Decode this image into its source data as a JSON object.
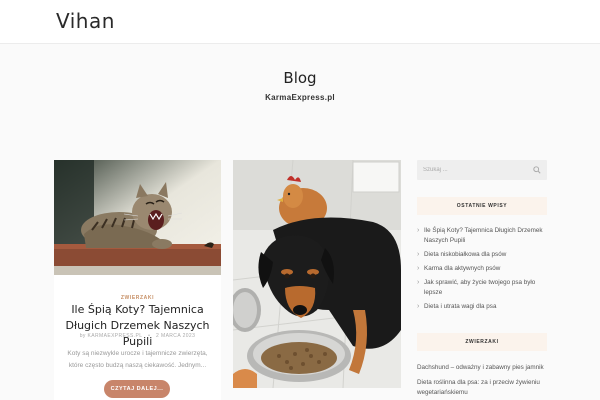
{
  "header": {
    "logo": "Vihan"
  },
  "hero": {
    "title": "Blog",
    "subtitle": "KarmaExpress.pl"
  },
  "post": {
    "category": "ZWIERZAKI",
    "title": "Ile Śpią Koty? Tajemnica Długich Drzemek Naszych Pupili",
    "author": "by KARMAEXPRESS.PL",
    "separator": "•",
    "date": "2 MARCA 2023",
    "excerpt": "Koty są niezwykle urocze i tajemnicze zwierzęta, które często budzą naszą ciekawość. Jednym...",
    "read_more": "CZYTAJ DALEJ..."
  },
  "sidebar": {
    "search_placeholder": "Szukaj ...",
    "recent_title": "OSTATNIE WPISY",
    "recent_posts": [
      "Ile Śpią Koty? Tajemnica Długich Drzemek Naszych Pupili",
      "Dieta niskobiałkowa dla psów",
      "Karma dla aktywnych psów",
      "Jak sprawić, aby życie twojego psa było lepsze",
      "Dieta i utrata wagi dla psa"
    ],
    "categories_title": "ZWIERZAKI",
    "category_posts": [
      "Dachshund – odważny i zabawny pies jamnik",
      "Dieta roślinna dla psa: za i przeciw żywieniu wegetariańskiemu"
    ]
  },
  "colors": {
    "accent": "#c8856a",
    "category": "#c79066",
    "widget_bg": "#fbf3ec"
  },
  "icons": {
    "search": "search-icon"
  }
}
